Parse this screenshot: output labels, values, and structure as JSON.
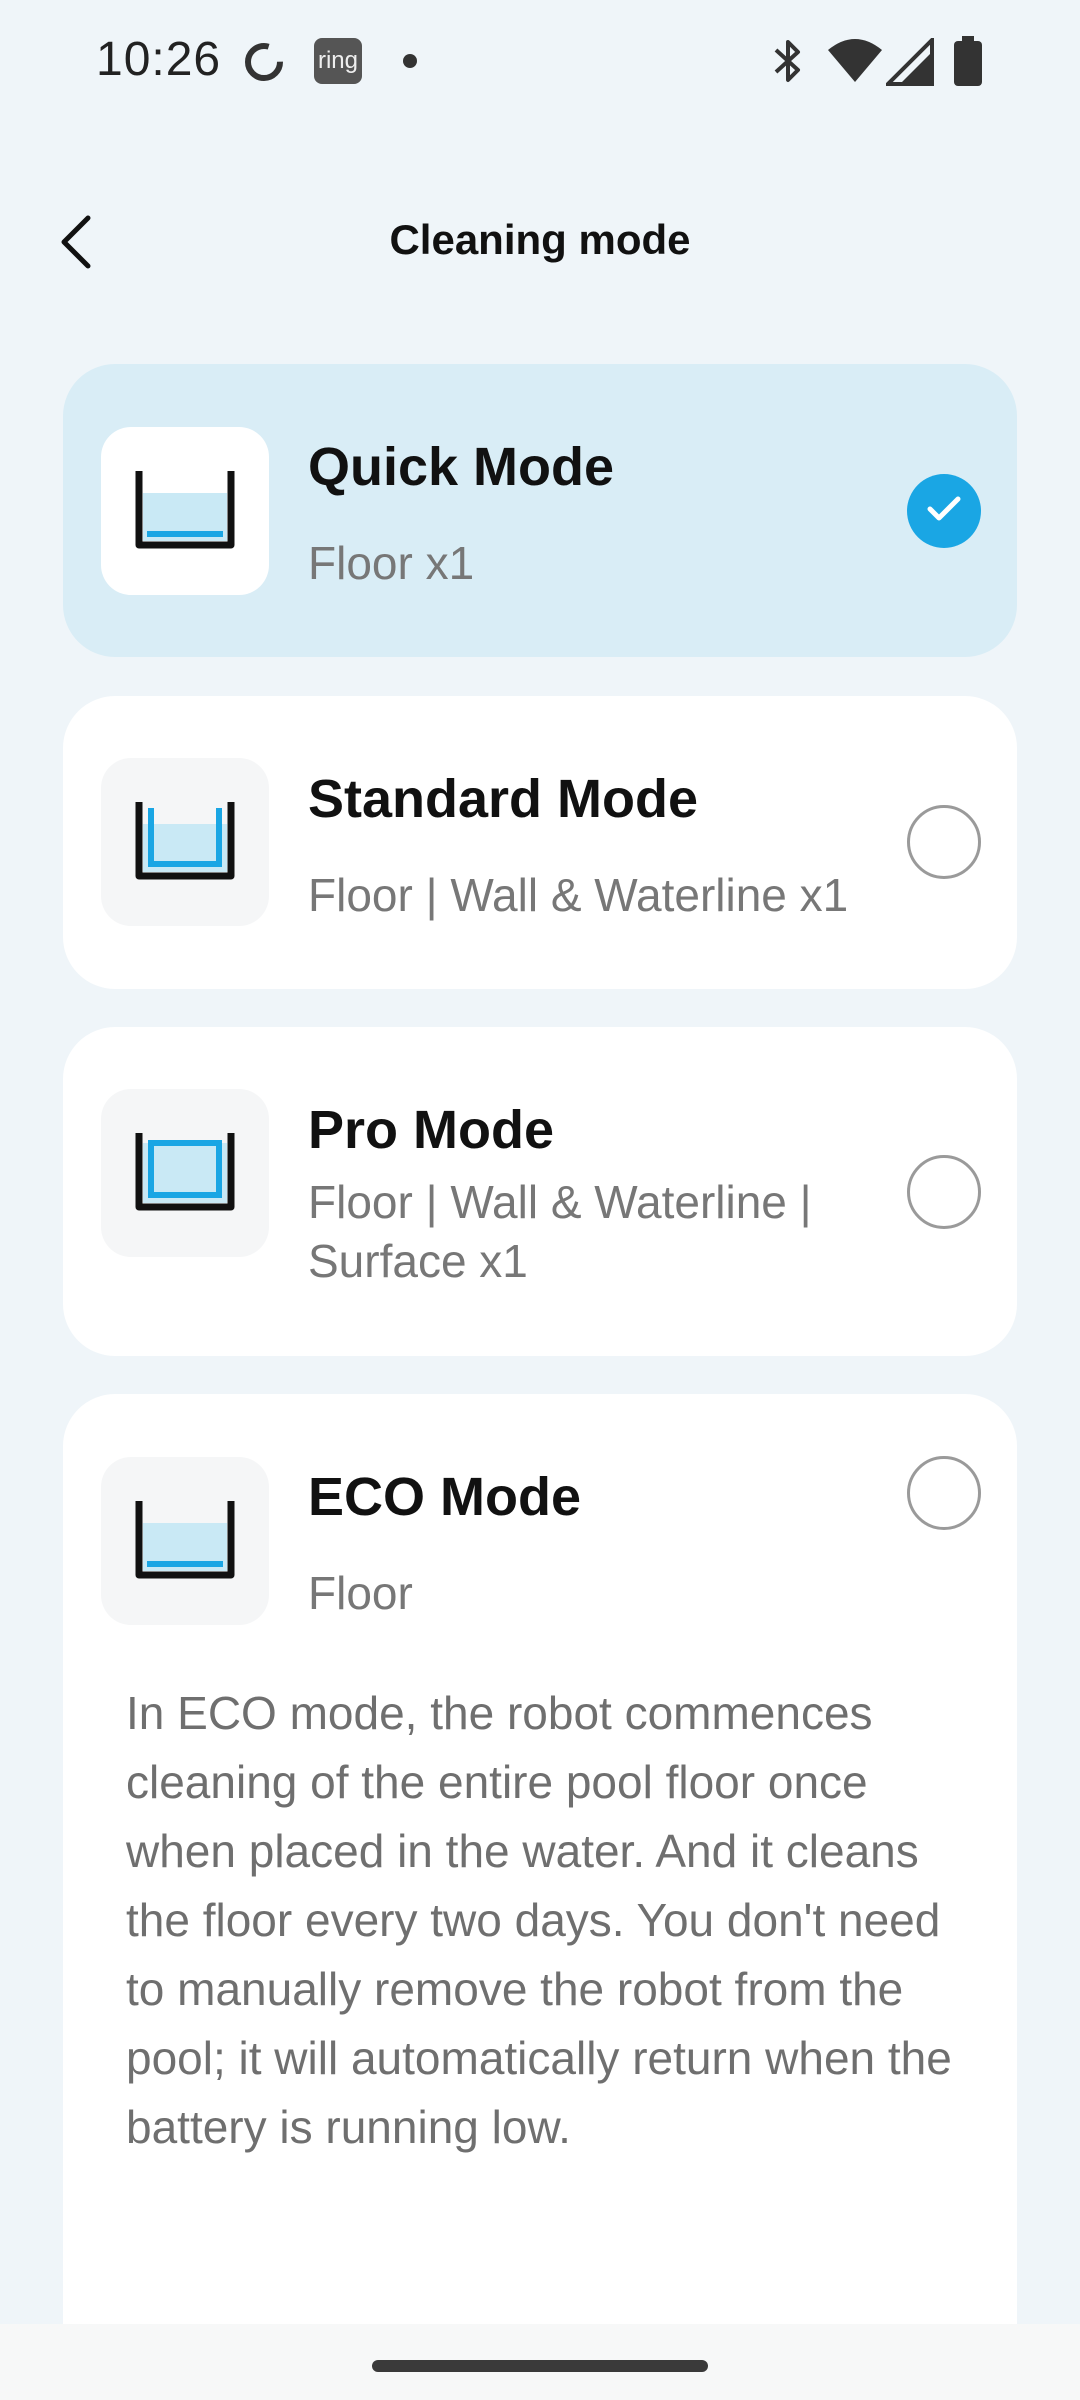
{
  "status_bar": {
    "time": "10:26",
    "ring_label": "ring",
    "icons": [
      "circle-notification-icon",
      "ring-app-icon",
      "dot-icon",
      "bluetooth-icon",
      "wifi-icon",
      "signal-icon",
      "battery-icon"
    ]
  },
  "header": {
    "title": "Cleaning mode",
    "back_icon": "chevron-left-icon"
  },
  "modes": [
    {
      "title": "Quick Mode",
      "subtitle": "Floor x1",
      "selected": true,
      "icon": "pool-floor-icon"
    },
    {
      "title": "Standard Mode",
      "subtitle": "Floor | Wall & Waterline x1",
      "selected": false,
      "icon": "pool-floor-wall-icon"
    },
    {
      "title": "Pro Mode",
      "subtitle_line1": "Floor | Wall & Waterline |",
      "subtitle_line2": "Surface x1",
      "selected": false,
      "icon": "pool-full-icon"
    },
    {
      "title": "ECO Mode",
      "subtitle": "Floor",
      "selected": false,
      "icon": "pool-floor-icon",
      "description": "In ECO mode, the robot commences cleaning of the entire pool floor once when placed in the water. And it cleans the floor every two days. You don't need to manually remove the robot from the pool; it will automatically return when the battery is running low."
    }
  ],
  "colors": {
    "accent": "#1aa6e4",
    "selected_card": "#d9edf6",
    "background": "#eff5f9",
    "water_fill": "#c9e9f5"
  }
}
